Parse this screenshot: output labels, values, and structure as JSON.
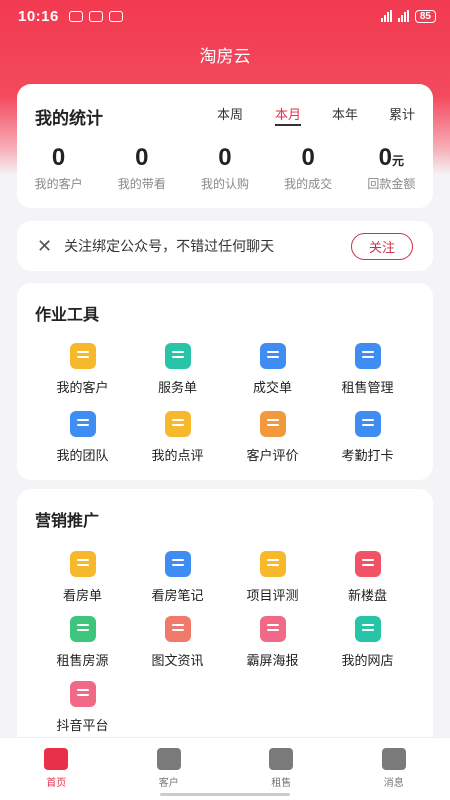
{
  "status_bar": {
    "time": "10:16",
    "battery": "85"
  },
  "app_title": "淘房云",
  "stats": {
    "title": "我的统计",
    "periods": [
      "本周",
      "本月",
      "本年",
      "累计"
    ],
    "active_period": "本月",
    "items": [
      {
        "value": "0",
        "unit": "",
        "label": "我的客户"
      },
      {
        "value": "0",
        "unit": "",
        "label": "我的带看"
      },
      {
        "value": "0",
        "unit": "",
        "label": "我的认购"
      },
      {
        "value": "0",
        "unit": "",
        "label": "我的成交"
      },
      {
        "value": "0",
        "unit": "元",
        "label": "回款金额"
      }
    ]
  },
  "notice": {
    "close": "✕",
    "text": "关注绑定公众号，不错过任何聊天",
    "button": "关注"
  },
  "tools": {
    "title": "作业工具",
    "items": [
      {
        "label": "我的客户",
        "icon": "customer-icon",
        "color": "#f8b82b"
      },
      {
        "label": "服务单",
        "icon": "calendar-icon",
        "color": "#27c4a7"
      },
      {
        "label": "成交单",
        "icon": "document-icon",
        "color": "#3f8df3"
      },
      {
        "label": "租售管理",
        "icon": "house-key-icon",
        "color": "#3f8df3"
      },
      {
        "label": "我的团队",
        "icon": "team-icon",
        "color": "#3f8df3"
      },
      {
        "label": "我的点评",
        "icon": "star-icon",
        "color": "#f8b82b"
      },
      {
        "label": "客户评价",
        "icon": "chat-icon",
        "color": "#f29a3b"
      },
      {
        "label": "考勤打卡",
        "icon": "checkin-icon",
        "color": "#3f8df3"
      }
    ]
  },
  "marketing": {
    "title": "营销推广",
    "items": [
      {
        "label": "看房单",
        "icon": "search-doc-icon",
        "color": "#f8b82b"
      },
      {
        "label": "看房笔记",
        "icon": "notes-icon",
        "color": "#3f8df3"
      },
      {
        "label": "项目评测",
        "icon": "chart-icon",
        "color": "#f8b82b"
      },
      {
        "label": "新楼盘",
        "icon": "building-icon",
        "color": "#f05366"
      },
      {
        "label": "租售房源",
        "icon": "house-icon",
        "color": "#3fc47b"
      },
      {
        "label": "图文资讯",
        "icon": "bookmark-icon",
        "color": "#f1796b"
      },
      {
        "label": "霸屏海报",
        "icon": "image-icon",
        "color": "#f06a87"
      },
      {
        "label": "我的网店",
        "icon": "shop-doc-icon",
        "color": "#27c4a7"
      },
      {
        "label": "抖音平台",
        "icon": "tiktok-icon",
        "color": "#f06a87"
      }
    ]
  },
  "tabbar": [
    {
      "label": "首页",
      "icon": "home-icon",
      "active": true
    },
    {
      "label": "客户",
      "icon": "person-icon",
      "active": false
    },
    {
      "label": "租售",
      "icon": "house-tab-icon",
      "active": false
    },
    {
      "label": "消息",
      "icon": "message-icon",
      "active": false
    }
  ]
}
